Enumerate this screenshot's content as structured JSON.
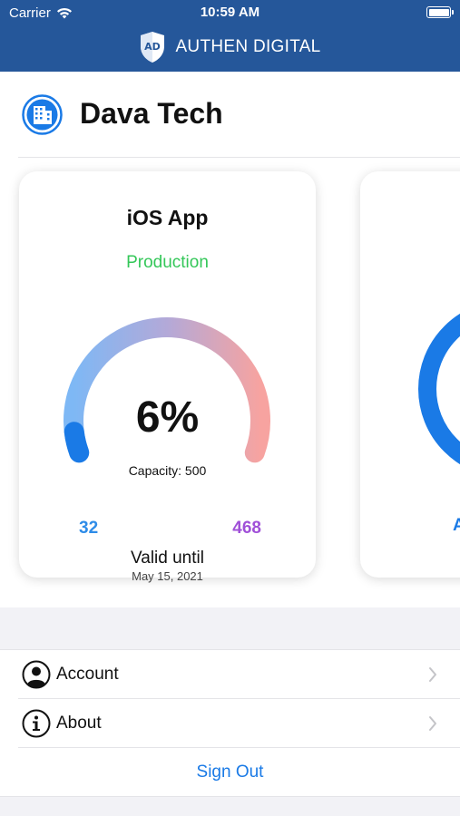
{
  "status_bar": {
    "carrier": "Carrier",
    "time": "10:59 AM"
  },
  "app": {
    "title": "AUTHEN DIGITAL",
    "logo_icon": "shield-logo-icon"
  },
  "company": {
    "name": "Dava Tech",
    "icon": "building-icon"
  },
  "cards": [
    {
      "title": "iOS App",
      "environment": "Production",
      "percent_label": "6%",
      "usage_fraction": 0.06,
      "capacity_label": "Capacity: 500",
      "used": "32",
      "remaining": "468",
      "valid_label": "Valid until",
      "valid_date": "May 15, 2021"
    },
    {
      "partial_label": "A"
    }
  ],
  "menu": {
    "items": [
      {
        "label": "Account",
        "icon": "user-circle-icon"
      },
      {
        "label": "About",
        "icon": "info-circle-icon"
      }
    ],
    "sign_out": "Sign Out"
  },
  "colors": {
    "header_bg": "#25579a",
    "production": "#34c759",
    "used": "#2e8ce8",
    "remaining": "#a050d8",
    "link": "#1a7ae6"
  }
}
